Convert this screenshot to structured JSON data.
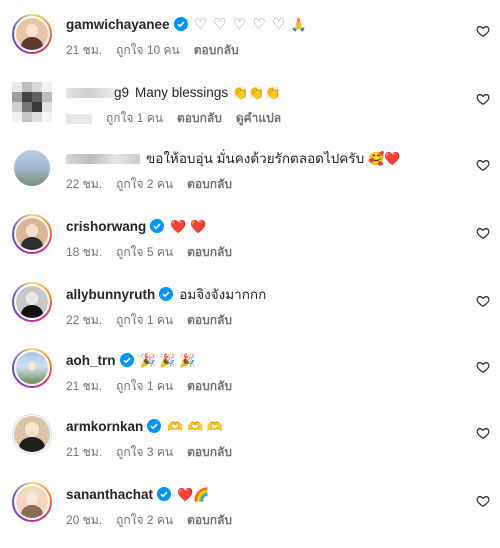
{
  "comments": [
    {
      "username": "gamwichayanee",
      "text": "",
      "time": "21 ชม.",
      "likes": "ถูกใจ 10 คน",
      "reply": "ตอบกลับ",
      "translate": "",
      "avatar": [
        "#f0d2b0",
        "#5b3a29"
      ],
      "emoji": "",
      "hearts": "♡ ♡ ♡ ♡ ♡",
      "extra": "🙏"
    },
    {
      "username": "g9",
      "text": "Many blessings",
      "time": "",
      "likes": "ถูกใจ 1 คน",
      "reply": "ตอบกลับ",
      "translate": "ดูคำแปล",
      "avatar": [],
      "emoji": "👏👏👏",
      "hearts": "",
      "extra": ""
    },
    {
      "username": "",
      "text": "ขอให้อบอุ่น มั่นคงด้วยรักตลอดไปครับ",
      "time": "22 ชม.",
      "likes": "ถูกใจ 2 คน",
      "reply": "ตอบกลับ",
      "translate": "",
      "avatar": [],
      "emoji": "🥰❤️",
      "hearts": "",
      "extra": ""
    },
    {
      "username": "crishorwang",
      "text": "",
      "time": "18 ชม.",
      "likes": "ถูกใจ 5 คน",
      "reply": "ตอบกลับ",
      "translate": "",
      "avatar": [
        "#d9b89a",
        "#2c2c2c"
      ],
      "emoji": "❤️ ❤️",
      "hearts": "",
      "extra": ""
    },
    {
      "username": "allybunnyruth",
      "text": "อมจิงจังมากกก",
      "time": "22 ชม.",
      "likes": "ถูกใจ 1 คน",
      "reply": "ตอบกลับ",
      "translate": "",
      "avatar": [
        "#c9c9c9",
        "#111111"
      ],
      "emoji": "",
      "hearts": "",
      "extra": ""
    },
    {
      "username": "aoh_trn",
      "text": "",
      "time": "21 ชม.",
      "likes": "ถูกใจ 1 คน",
      "reply": "ตอบกลับ",
      "translate": "",
      "avatar": [
        "#a9c6e8",
        "#4a6b3a"
      ],
      "emoji": "🎉 🎉 🎉",
      "hearts": "",
      "extra": ""
    },
    {
      "username": "armkornkan",
      "text": "",
      "time": "21 ชม.",
      "likes": "ถูกใจ 3 คน",
      "reply": "ตอบกลับ",
      "translate": "",
      "avatar": [
        "#d8c2a8",
        "#1f1f1f"
      ],
      "emoji": "🫶 🫶 🫶",
      "hearts": "",
      "extra": ""
    },
    {
      "username": "sananthachat",
      "text": "",
      "time": "20 ชม.",
      "likes": "ถูกใจ 2 คน",
      "reply": "ตอบกลับ",
      "translate": "",
      "avatar": [
        "#f2d7c3",
        "#8a6a52"
      ],
      "emoji": "❤️🌈",
      "hearts": "",
      "extra": ""
    }
  ],
  "colors": {
    "verified": "#0095f6",
    "muted": "#737373",
    "text": "#262626"
  }
}
